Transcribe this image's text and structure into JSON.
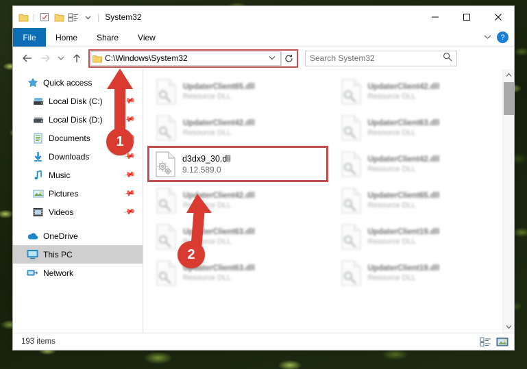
{
  "window": {
    "title": "System32",
    "quick_access_icons": [
      "folder-icon",
      "properties-checkbox-icon",
      "folder-icon",
      "customize-list-icon",
      "qat-dropdown-icon"
    ],
    "controls": {
      "minimize": "─",
      "maximize": "☐",
      "close": "✕"
    }
  },
  "ribbon": {
    "tabs": [
      {
        "label": "File",
        "active": true
      },
      {
        "label": "Home",
        "active": false
      },
      {
        "label": "Share",
        "active": false
      },
      {
        "label": "View",
        "active": false
      }
    ],
    "collapse_icon": "chevron-down-icon",
    "help_label": "?"
  },
  "address": {
    "back_icon": "←",
    "forward_icon": "→",
    "recent_icon": "⌄",
    "up_icon": "↑",
    "path": "C:\\Windows\\System32",
    "dropdown_icon": "⌄",
    "refresh_icon": "↻",
    "highlight_color": "#c0504d"
  },
  "search": {
    "placeholder": "Search System32",
    "icon": "search-icon"
  },
  "sidebar": {
    "items": [
      {
        "label": "Quick access",
        "icon": "star-icon",
        "pinned": false,
        "indent": false,
        "selected": false
      },
      {
        "label": "Local Disk (C:)",
        "icon": "drive-icon",
        "pinned": true,
        "indent": true,
        "selected": false
      },
      {
        "label": "Local Disk (D:)",
        "icon": "drive-icon",
        "pinned": true,
        "indent": true,
        "selected": false
      },
      {
        "label": "Documents",
        "icon": "documents-icon",
        "pinned": true,
        "indent": true,
        "selected": false
      },
      {
        "label": "Downloads",
        "icon": "downloads-icon",
        "pinned": true,
        "indent": true,
        "selected": false
      },
      {
        "label": "Music",
        "icon": "music-icon",
        "pinned": true,
        "indent": true,
        "selected": false
      },
      {
        "label": "Pictures",
        "icon": "pictures-icon",
        "pinned": true,
        "indent": true,
        "selected": false
      },
      {
        "label": "Videos",
        "icon": "videos-icon",
        "pinned": true,
        "indent": true,
        "selected": false
      },
      {
        "label": "OneDrive",
        "icon": "onedrive-icon",
        "pinned": false,
        "indent": false,
        "selected": false
      },
      {
        "label": "This PC",
        "icon": "computer-icon",
        "pinned": false,
        "indent": false,
        "selected": true
      },
      {
        "label": "Network",
        "icon": "network-icon",
        "pinned": false,
        "indent": false,
        "selected": false
      }
    ]
  },
  "files": [
    {
      "name": "UpdaterClient65.dll",
      "sub": "Resource DLL",
      "selected": false
    },
    {
      "name": "UpdaterClient42.dll",
      "sub": "Resource DLL",
      "selected": false
    },
    {
      "name": "UpdaterClient42.dll",
      "sub": "Resource DLL",
      "selected": false
    },
    {
      "name": "UpdaterClient63.dll",
      "sub": "Resource DLL",
      "selected": false
    },
    {
      "name": "d3dx9_30.dll",
      "sub": "9.12.589.0",
      "selected": true
    },
    {
      "name": "UpdaterClient42.dll",
      "sub": "Resource DLL",
      "selected": false
    },
    {
      "name": "UpdaterClient42.dll",
      "sub": "Resource DLL",
      "selected": false
    },
    {
      "name": "UpdaterClient65.dll",
      "sub": "Resource DLL",
      "selected": false
    },
    {
      "name": "UpdaterClient63.dll",
      "sub": "Resource DLL",
      "selected": false
    },
    {
      "name": "UpdaterClient19.dll",
      "sub": "Resource DLL",
      "selected": false
    },
    {
      "name": "UpdaterClient63.dll",
      "sub": "Resource DLL",
      "selected": false
    },
    {
      "name": "UpdaterClient19.dll",
      "sub": "Resource DLL",
      "selected": false
    }
  ],
  "statusbar": {
    "item_count": "193 items",
    "view_details_icon": "details-view-icon",
    "view_large_icons_icon": "large-icons-view-icon"
  },
  "annotations": [
    {
      "id": "1",
      "label": "1",
      "target": "address-bar",
      "color": "#d93b30"
    },
    {
      "id": "2",
      "label": "2",
      "target": "selected-file",
      "color": "#d93b30"
    }
  ]
}
